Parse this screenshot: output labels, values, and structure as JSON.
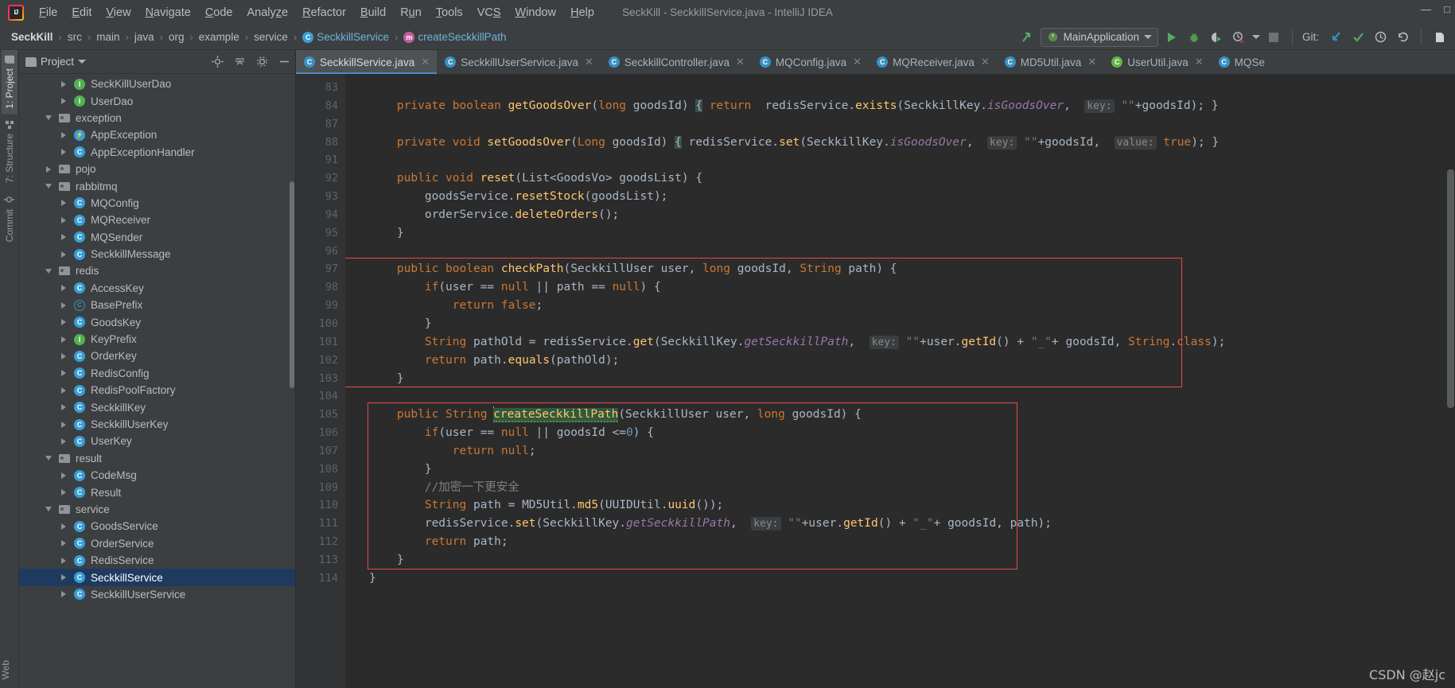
{
  "window": {
    "title": "SeckKill - SeckkillService.java - IntelliJ IDEA",
    "minimize": "—",
    "maximize": "□",
    "close": "✕"
  },
  "menubar": {
    "items": [
      {
        "label": "File"
      },
      {
        "label": "Edit"
      },
      {
        "label": "View"
      },
      {
        "label": "Navigate"
      },
      {
        "label": "Code"
      },
      {
        "label": "Analyze"
      },
      {
        "label": "Refactor"
      },
      {
        "label": "Build"
      },
      {
        "label": "Run"
      },
      {
        "label": "Tools"
      },
      {
        "label": "VCS"
      },
      {
        "label": "Window"
      },
      {
        "label": "Help"
      }
    ]
  },
  "breadcrumb": {
    "items": [
      {
        "label": "SeckKill",
        "icon": "none",
        "bold": true
      },
      {
        "label": "src",
        "icon": "none"
      },
      {
        "label": "main",
        "icon": "none"
      },
      {
        "label": "java",
        "icon": "none"
      },
      {
        "label": "org",
        "icon": "none"
      },
      {
        "label": "example",
        "icon": "none"
      },
      {
        "label": "service",
        "icon": "none"
      },
      {
        "label": "SeckkillService",
        "icon": "class-icon"
      },
      {
        "label": "createSeckkillPath",
        "icon": "method-icon"
      }
    ],
    "separator": "›"
  },
  "toolbar": {
    "run_config": "MainApplication",
    "run_button": "run-icon",
    "debug_button": "debug-icon",
    "coverage_button": "coverage-icon",
    "profile_button": "profile-icon",
    "stop_button": "stop-icon",
    "git_label": "Git:",
    "git_update": "update-project-icon",
    "git_commit": "commit-icon",
    "git_history": "history-icon",
    "git_rollback": "rollback-icon",
    "search_everywhere": "search-icon"
  },
  "left_strip": {
    "tabs": [
      {
        "label": "1: Project",
        "icon": "folder-icon",
        "active": true
      },
      {
        "label": "7: Structure",
        "icon": "structure-icon",
        "active": false
      },
      {
        "label": "Commit",
        "icon": "commit-icon",
        "active": false
      }
    ],
    "bottom_tab": {
      "label": "Web",
      "icon": "web-icon"
    }
  },
  "project_panel": {
    "title": "Project",
    "dropdown": "▾",
    "actions": [
      "locate-icon",
      "collapse-all-icon",
      "settings-icon",
      "hide-icon"
    ],
    "tree": [
      {
        "indent": 2,
        "arrow": "right",
        "icon": "interface-icon",
        "label": "SeckKillUserDao",
        "selected": false
      },
      {
        "indent": 2,
        "arrow": "right",
        "icon": "interface-icon",
        "label": "UserDao",
        "selected": false
      },
      {
        "indent": 1,
        "arrow": "down",
        "icon": "folder-icon",
        "label": "exception",
        "selected": false
      },
      {
        "indent": 2,
        "arrow": "right",
        "icon": "exception-icon",
        "label": "AppException",
        "selected": false
      },
      {
        "indent": 2,
        "arrow": "right",
        "icon": "class-icon",
        "label": "AppExceptionHandler",
        "selected": false
      },
      {
        "indent": 1,
        "arrow": "right",
        "icon": "folder-icon",
        "label": "pojo",
        "selected": false
      },
      {
        "indent": 1,
        "arrow": "down",
        "icon": "folder-icon",
        "label": "rabbitmq",
        "selected": false
      },
      {
        "indent": 2,
        "arrow": "right",
        "icon": "class-icon",
        "label": "MQConfig",
        "selected": false
      },
      {
        "indent": 2,
        "arrow": "right",
        "icon": "class-icon",
        "label": "MQReceiver",
        "selected": false
      },
      {
        "indent": 2,
        "arrow": "right",
        "icon": "class-icon",
        "label": "MQSender",
        "selected": false
      },
      {
        "indent": 2,
        "arrow": "right",
        "icon": "class-icon",
        "label": "SeckkillMessage",
        "selected": false
      },
      {
        "indent": 1,
        "arrow": "down",
        "icon": "folder-icon",
        "label": "redis",
        "selected": false
      },
      {
        "indent": 2,
        "arrow": "right",
        "icon": "class-icon",
        "label": "AccessKey",
        "selected": false
      },
      {
        "indent": 2,
        "arrow": "right",
        "icon": "abstract-class-icon",
        "label": "BasePrefix",
        "selected": false
      },
      {
        "indent": 2,
        "arrow": "right",
        "icon": "class-icon",
        "label": "GoodsKey",
        "selected": false
      },
      {
        "indent": 2,
        "arrow": "right",
        "icon": "interface-icon",
        "label": "KeyPrefix",
        "selected": false
      },
      {
        "indent": 2,
        "arrow": "right",
        "icon": "class-icon",
        "label": "OrderKey",
        "selected": false
      },
      {
        "indent": 2,
        "arrow": "right",
        "icon": "class-icon",
        "label": "RedisConfig",
        "selected": false
      },
      {
        "indent": 2,
        "arrow": "right",
        "icon": "class-icon",
        "label": "RedisPoolFactory",
        "selected": false
      },
      {
        "indent": 2,
        "arrow": "right",
        "icon": "class-icon",
        "label": "SeckkillKey",
        "selected": false
      },
      {
        "indent": 2,
        "arrow": "right",
        "icon": "class-icon",
        "label": "SeckkillUserKey",
        "selected": false
      },
      {
        "indent": 2,
        "arrow": "right",
        "icon": "class-icon",
        "label": "UserKey",
        "selected": false
      },
      {
        "indent": 1,
        "arrow": "down",
        "icon": "folder-icon",
        "label": "result",
        "selected": false
      },
      {
        "indent": 2,
        "arrow": "right",
        "icon": "class-icon",
        "label": "CodeMsg",
        "selected": false
      },
      {
        "indent": 2,
        "arrow": "right",
        "icon": "class-icon",
        "label": "Result",
        "selected": false
      },
      {
        "indent": 1,
        "arrow": "down",
        "icon": "folder-icon",
        "label": "service",
        "selected": false
      },
      {
        "indent": 2,
        "arrow": "right",
        "icon": "class-icon",
        "label": "GoodsService",
        "selected": false
      },
      {
        "indent": 2,
        "arrow": "right",
        "icon": "class-icon",
        "label": "OrderService",
        "selected": false
      },
      {
        "indent": 2,
        "arrow": "right",
        "icon": "class-icon",
        "label": "RedisService",
        "selected": false
      },
      {
        "indent": 2,
        "arrow": "right",
        "icon": "class-icon",
        "label": "SeckkillService",
        "selected": true
      },
      {
        "indent": 2,
        "arrow": "right",
        "icon": "class-icon",
        "label": "SeckkillUserService",
        "selected": false
      }
    ]
  },
  "editor_tabs": [
    {
      "label": "SeckkillService.java",
      "icon": "class-icon",
      "active": true,
      "close": "✕"
    },
    {
      "label": "SeckkillUserService.java",
      "icon": "class-icon",
      "active": false,
      "close": "✕"
    },
    {
      "label": "SeckkillController.java",
      "icon": "class-icon",
      "active": false,
      "close": "✕"
    },
    {
      "label": "MQConfig.java",
      "icon": "class-icon",
      "active": false,
      "close": "✕"
    },
    {
      "label": "MQReceiver.java",
      "icon": "class-icon",
      "active": false,
      "close": "✕"
    },
    {
      "label": "MD5Util.java",
      "icon": "class-icon",
      "active": false,
      "close": "✕"
    },
    {
      "label": "UserUtil.java",
      "icon": "class-icon-green",
      "active": false,
      "close": "✕"
    },
    {
      "label": "MQSe",
      "icon": "class-icon",
      "active": false,
      "close": ""
    }
  ],
  "code": {
    "lines": [
      {
        "num": "83",
        "fold": "",
        "bulb": false,
        "text": ""
      },
      {
        "num": "84",
        "fold": "plus",
        "bulb": false,
        "text": "    private boolean getGoodsOver(long goodsId) { return  redisService.exists(SeckkillKey.isGoodsOver,  key: \"\"+goodsId); }"
      },
      {
        "num": "87",
        "fold": "",
        "bulb": false,
        "text": ""
      },
      {
        "num": "88",
        "fold": "plus",
        "bulb": false,
        "text": "    private void setGoodsOver(Long goodsId) { redisService.set(SeckkillKey.isGoodsOver,  key: \"\"+goodsId,  value: true); }"
      },
      {
        "num": "91",
        "fold": "",
        "bulb": false,
        "text": ""
      },
      {
        "num": "92",
        "fold": "minus",
        "bulb": false,
        "text": "    public void reset(List<GoodsVo> goodsList) {"
      },
      {
        "num": "93",
        "fold": "",
        "bulb": false,
        "text": "        goodsService.resetStock(goodsList);"
      },
      {
        "num": "94",
        "fold": "",
        "bulb": false,
        "text": "        orderService.deleteOrders();"
      },
      {
        "num": "95",
        "fold": "end",
        "bulb": false,
        "text": "    }"
      },
      {
        "num": "96",
        "fold": "",
        "bulb": false,
        "text": ""
      },
      {
        "num": "97",
        "fold": "minus",
        "bulb": false,
        "text": "    public boolean checkPath(SeckkillUser user, long goodsId, String path) {"
      },
      {
        "num": "98",
        "fold": "minus",
        "bulb": false,
        "text": "        if(user == null || path == null) {"
      },
      {
        "num": "99",
        "fold": "",
        "bulb": false,
        "text": "            return false;"
      },
      {
        "num": "100",
        "fold": "end",
        "bulb": false,
        "text": "        }"
      },
      {
        "num": "101",
        "fold": "",
        "bulb": false,
        "text": "        String pathOld = redisService.get(SeckkillKey.getSeckkillPath,  key: \"\"+user.getId() + \"_\"+ goodsId, String.class);"
      },
      {
        "num": "102",
        "fold": "",
        "bulb": false,
        "text": "        return path.equals(pathOld);"
      },
      {
        "num": "103",
        "fold": "end",
        "bulb": false,
        "text": "    }"
      },
      {
        "num": "104",
        "fold": "",
        "bulb": false,
        "text": ""
      },
      {
        "num": "105",
        "fold": "minus",
        "bulb": true,
        "text": "    public String createSeckkillPath(SeckkillUser user, long goodsId) {"
      },
      {
        "num": "106",
        "fold": "minus",
        "bulb": false,
        "text": "        if(user == null || goodsId <=0) {"
      },
      {
        "num": "107",
        "fold": "",
        "bulb": false,
        "text": "            return null;"
      },
      {
        "num": "108",
        "fold": "end",
        "bulb": false,
        "text": "        }"
      },
      {
        "num": "109",
        "fold": "",
        "bulb": false,
        "text": "        //加密一下更安全"
      },
      {
        "num": "110",
        "fold": "",
        "bulb": false,
        "text": "        String path = MD5Util.md5(UUIDUtil.uuid());"
      },
      {
        "num": "111",
        "fold": "",
        "bulb": false,
        "text": "        redisService.set(SeckkillKey.getSeckkillPath,  key: \"\"+user.getId() + \"_\"+ goodsId, path);"
      },
      {
        "num": "112",
        "fold": "",
        "bulb": false,
        "text": "        return path;"
      },
      {
        "num": "113",
        "fold": "end",
        "bulb": false,
        "text": "    }"
      },
      {
        "num": "114",
        "fold": "",
        "bulb": false,
        "text": "}"
      }
    ],
    "selected_symbol": "createSeckkillPath",
    "annotation_boxes": [
      {
        "name": "checkPath-highlight",
        "start_line": "97",
        "end_line": "103"
      },
      {
        "name": "createSeckkillPath-highlight",
        "start_line": "105",
        "end_line": "113"
      }
    ]
  },
  "watermark": "CSDN @赵jc",
  "colors": {
    "accent": "#4a88c7",
    "annotation_red": "#e84a4a",
    "selection_blue": "#1f3a5f",
    "keyword_orange": "#cc7832",
    "method_yellow": "#ffc66d",
    "string_green": "#6a8759",
    "number_blue": "#6897bb",
    "field_purple": "#9876aa",
    "editor_bg": "#2b2b2b",
    "panel_bg": "#3c3f41"
  }
}
